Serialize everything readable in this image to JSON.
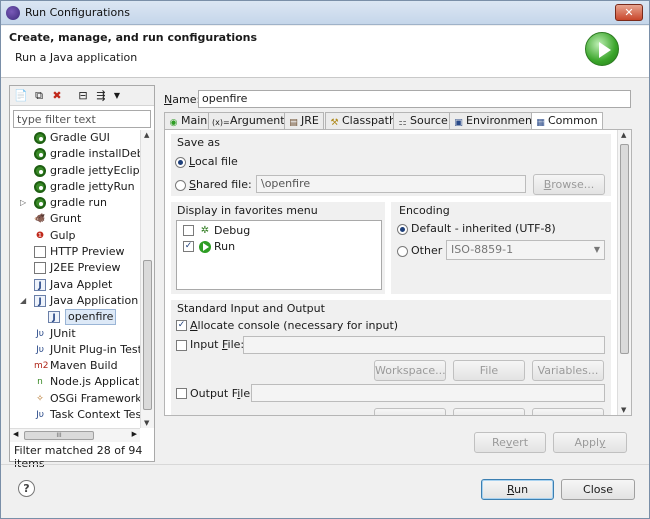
{
  "window": {
    "title": "Run Configurations",
    "close_glyph": "✕"
  },
  "header": {
    "title": "Create, manage, and run configurations",
    "subtitle": "Run a Java application"
  },
  "left": {
    "filter_placeholder": "type filter text",
    "tree": [
      {
        "label": "Gradle GUI",
        "icon": "gear-green",
        "expand": ""
      },
      {
        "label": "gradle installDebug",
        "icon": "gear-green",
        "expand": ""
      },
      {
        "label": "gradle jettyEclipseRun",
        "icon": "gear-green",
        "expand": ""
      },
      {
        "label": "gradle jettyRun",
        "icon": "gear-green",
        "expand": ""
      },
      {
        "label": "gradle run",
        "icon": "gear-green",
        "expand": "▷"
      },
      {
        "label": "Grunt",
        "icon": "grunt",
        "expand": ""
      },
      {
        "label": "Gulp",
        "icon": "gulp",
        "expand": ""
      },
      {
        "label": "HTTP Preview",
        "icon": "file",
        "expand": ""
      },
      {
        "label": "J2EE Preview",
        "icon": "file",
        "expand": ""
      },
      {
        "label": "Java Applet",
        "icon": "java-applet",
        "expand": ""
      },
      {
        "label": "Java Application",
        "icon": "java",
        "expand": "◢"
      },
      {
        "label": "openfire",
        "icon": "java",
        "expand": "",
        "child": true,
        "selected": true
      },
      {
        "label": "JUnit",
        "icon": "junit",
        "expand": ""
      },
      {
        "label": "JUnit Plug-in Test",
        "icon": "junit-plugin",
        "expand": ""
      },
      {
        "label": "Maven Build",
        "icon": "maven",
        "expand": ""
      },
      {
        "label": "Node.js Application",
        "icon": "node",
        "expand": ""
      },
      {
        "label": "OSGi Framework",
        "icon": "osgi",
        "expand": ""
      },
      {
        "label": "Task Context Test",
        "icon": "task",
        "expand": ""
      }
    ],
    "hscroll_label": "III",
    "status": "Filter matched 28 of 94 items"
  },
  "main": {
    "name_label": "Name:",
    "name_value": "openfire",
    "tabs": [
      {
        "label": "Main",
        "icon": "main-tab-icon"
      },
      {
        "label": "Arguments",
        "icon": "arguments-tab-icon"
      },
      {
        "label": "JRE",
        "icon": "jre-tab-icon"
      },
      {
        "label": "Classpath",
        "icon": "classpath-tab-icon"
      },
      {
        "label": "Source",
        "icon": "source-tab-icon"
      },
      {
        "label": "Environment",
        "icon": "environment-tab-icon"
      },
      {
        "label": "Common",
        "icon": "common-tab-icon"
      }
    ],
    "save_as": {
      "label": "Save as",
      "local": "Local file",
      "shared": "Shared file:",
      "shared_value": "\\openfire",
      "browse": "Browse..."
    },
    "favorites": {
      "label": "Display in favorites menu",
      "items": [
        {
          "label": "Debug",
          "checked": false
        },
        {
          "label": "Run",
          "checked": true
        }
      ]
    },
    "encoding": {
      "label": "Encoding",
      "default": "Default - inherited (UTF-8)",
      "other": "Other",
      "other_value": "ISO-8859-1"
    },
    "io": {
      "label": "Standard Input and Output",
      "allocate": "Allocate console (necessary for input)",
      "input_file": "Input File:",
      "workspace": "Workspace...",
      "file_system": "File System...",
      "variables": "Variables...",
      "output_file": "Output File:"
    },
    "revert": "Revert",
    "apply": "Apply"
  },
  "footer": {
    "run": "Run",
    "close": "Close",
    "help_glyph": "?"
  }
}
